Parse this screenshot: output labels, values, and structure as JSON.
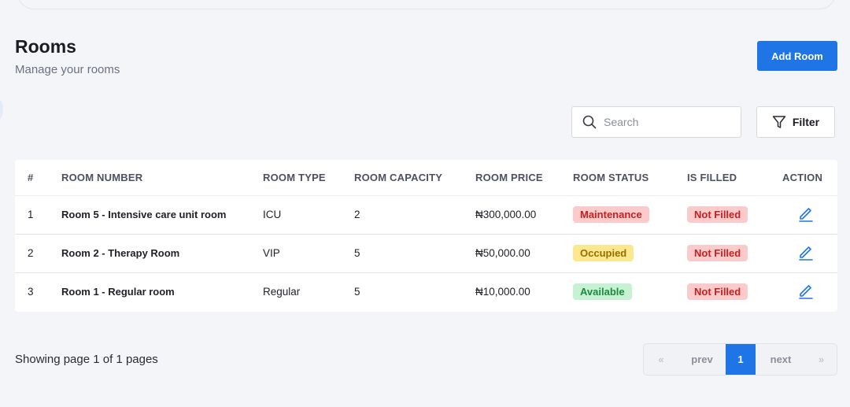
{
  "header": {
    "title": "Rooms",
    "subtitle": "Manage your rooms",
    "add_button": "Add Room"
  },
  "toolbar": {
    "search_placeholder": "Search",
    "filter_label": "Filter"
  },
  "table": {
    "columns": [
      "#",
      "ROOM NUMBER",
      "ROOM TYPE",
      "ROOM CAPACITY",
      "ROOM PRICE",
      "ROOM STATUS",
      "IS FILLED",
      "ACTION"
    ],
    "rows": [
      {
        "index": "1",
        "room_number": "Room 5 - Intensive care unit room",
        "room_type": "ICU",
        "capacity": "2",
        "price": "₦300,000.00",
        "status": "Maintenance",
        "is_filled": "Not Filled"
      },
      {
        "index": "2",
        "room_number": "Room 2 - Therapy Room",
        "room_type": "VIP",
        "capacity": "5",
        "price": "₦50,000.00",
        "status": "Occupied",
        "is_filled": "Not Filled"
      },
      {
        "index": "3",
        "room_number": "Room 1 - Regular room",
        "room_type": "Regular",
        "capacity": "5",
        "price": "₦10,000.00",
        "status": "Available",
        "is_filled": "Not Filled"
      }
    ]
  },
  "pagination": {
    "summary": "Showing page 1 of 1 pages",
    "first": "«",
    "prev": "prev",
    "current": "1",
    "next": "next",
    "last": "»"
  },
  "colors": {
    "accent": "#1f74e6",
    "maintenance": "#c42121",
    "occupied": "#9a6c00",
    "available": "#1d8a3e"
  },
  "icons": {
    "search": "search-icon",
    "filter": "filter-icon",
    "edit": "pencil-edit-icon"
  }
}
